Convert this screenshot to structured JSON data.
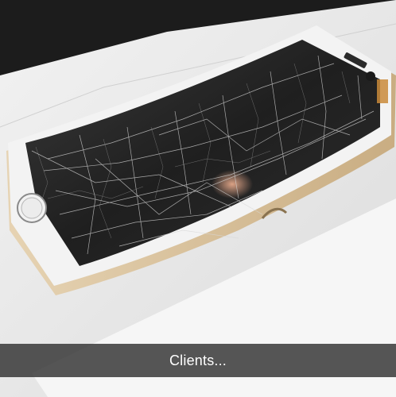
{
  "caption": {
    "text": "Clients..."
  },
  "colors": {
    "background_top": "#1a1a1a",
    "table_surface": "#ececec",
    "phone_frame_gold": "#d8c3a0",
    "phone_bezel_white": "#f4f4f4",
    "screen_dark": "#2a2a2a",
    "caption_bar": "#282828"
  },
  "photo": {
    "subject_icons": [
      "bent-phone-icon",
      "shattered-glass-icon",
      "home-button-icon"
    ]
  }
}
